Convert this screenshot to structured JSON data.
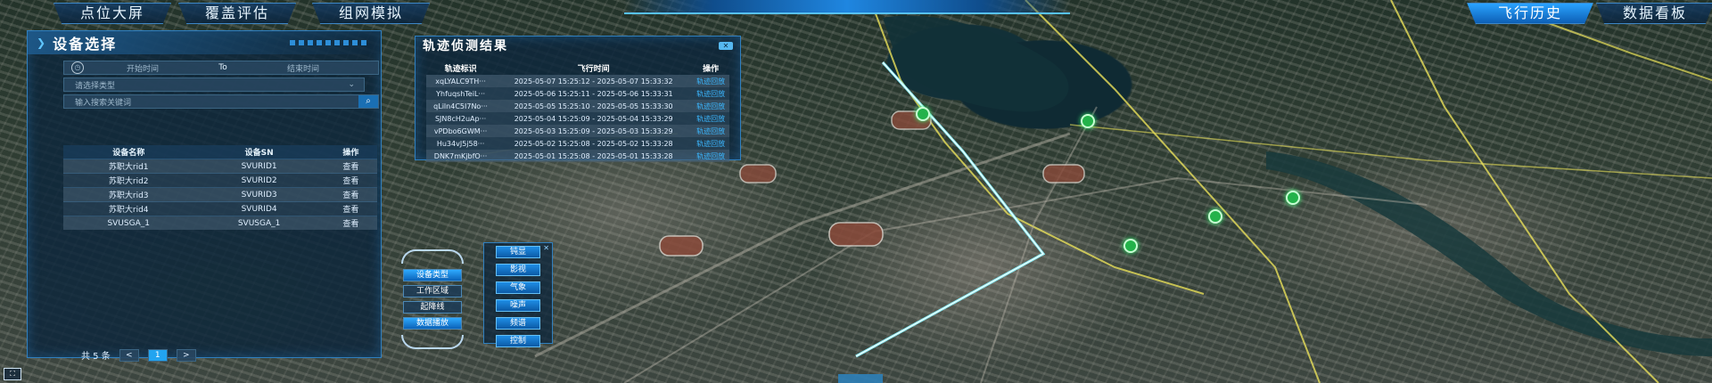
{
  "nav": {
    "left_tabs": [
      "点位大屏",
      "覆盖评估",
      "组网模拟"
    ],
    "right_tabs": [
      "飞行历史",
      "数据看板"
    ],
    "active_tab": "飞行历史"
  },
  "device_panel": {
    "title": "设备选择",
    "start_time_placeholder": "开始时间",
    "to_label": "To",
    "end_time_placeholder": "结束时间",
    "type_select_placeholder": "请选择类型",
    "keyword_placeholder": "输入搜索关键词",
    "columns": [
      "设备名称",
      "设备SN",
      "操作"
    ],
    "rows": [
      {
        "name": "苏职大rid1",
        "sn": "SVURID1",
        "op": "查看"
      },
      {
        "name": "苏职大rid2",
        "sn": "SVURID2",
        "op": "查看"
      },
      {
        "name": "苏职大rid3",
        "sn": "SVURID3",
        "op": "查看"
      },
      {
        "name": "苏职大rid4",
        "sn": "SVURID4",
        "op": "查看"
      },
      {
        "name": "SVUSGA_1",
        "sn": "SVUSGA_1",
        "op": "查看"
      }
    ],
    "pager": {
      "total": "共 5 条",
      "prev": "<",
      "page": "1",
      "next": ">"
    }
  },
  "track_panel": {
    "title": "轨迹侦测结果",
    "close": "✕",
    "columns": [
      "轨迹标识",
      "飞行时间",
      "操作"
    ],
    "rows": [
      {
        "id": "xqLYALC9TH···",
        "time": "2025-05-07 15:25:12 - 2025-05-07 15:33:32",
        "op": "轨迹回放"
      },
      {
        "id": "YhfuqshTeiL···",
        "time": "2025-05-06 15:25:11 - 2025-05-06 15:33:31",
        "op": "轨迹回放"
      },
      {
        "id": "qLiln4C5I7No···",
        "time": "2025-05-05 15:25:10 - 2025-05-05 15:33:30",
        "op": "轨迹回放"
      },
      {
        "id": "SJN8cH2uAp···",
        "time": "2025-05-04 15:25:09 - 2025-05-04 15:33:29",
        "op": "轨迹回放"
      },
      {
        "id": "vPDbo6GWM···",
        "time": "2025-05-03 15:25:09 - 2025-05-03 15:33:29",
        "op": "轨迹回放"
      },
      {
        "id": "Hu34vJ5j58···",
        "time": "2025-05-02 15:25:08 - 2025-05-02 15:33:28",
        "op": "轨迹回放"
      },
      {
        "id": "DNK7mKjbfO···",
        "time": "2025-05-01 15:25:08 - 2025-05-01 15:33:28",
        "op": "轨迹回放"
      }
    ]
  },
  "layer_panel": {
    "buttons": [
      "设备类型",
      "工作区域",
      "起降线",
      "数据播放"
    ],
    "active": "设备类型"
  },
  "ctrl_panel": {
    "buttons": [
      "钝显",
      "影视",
      "气象",
      "噪声",
      "频谱",
      "控制"
    ],
    "close": "✕"
  },
  "corner_icon": "⛶",
  "colors": {
    "accent": "#22a4f0",
    "panel": "#0c263c",
    "flight_track": "#8ff6ff",
    "road": "#e8e05a",
    "pin": "#23b24a"
  }
}
